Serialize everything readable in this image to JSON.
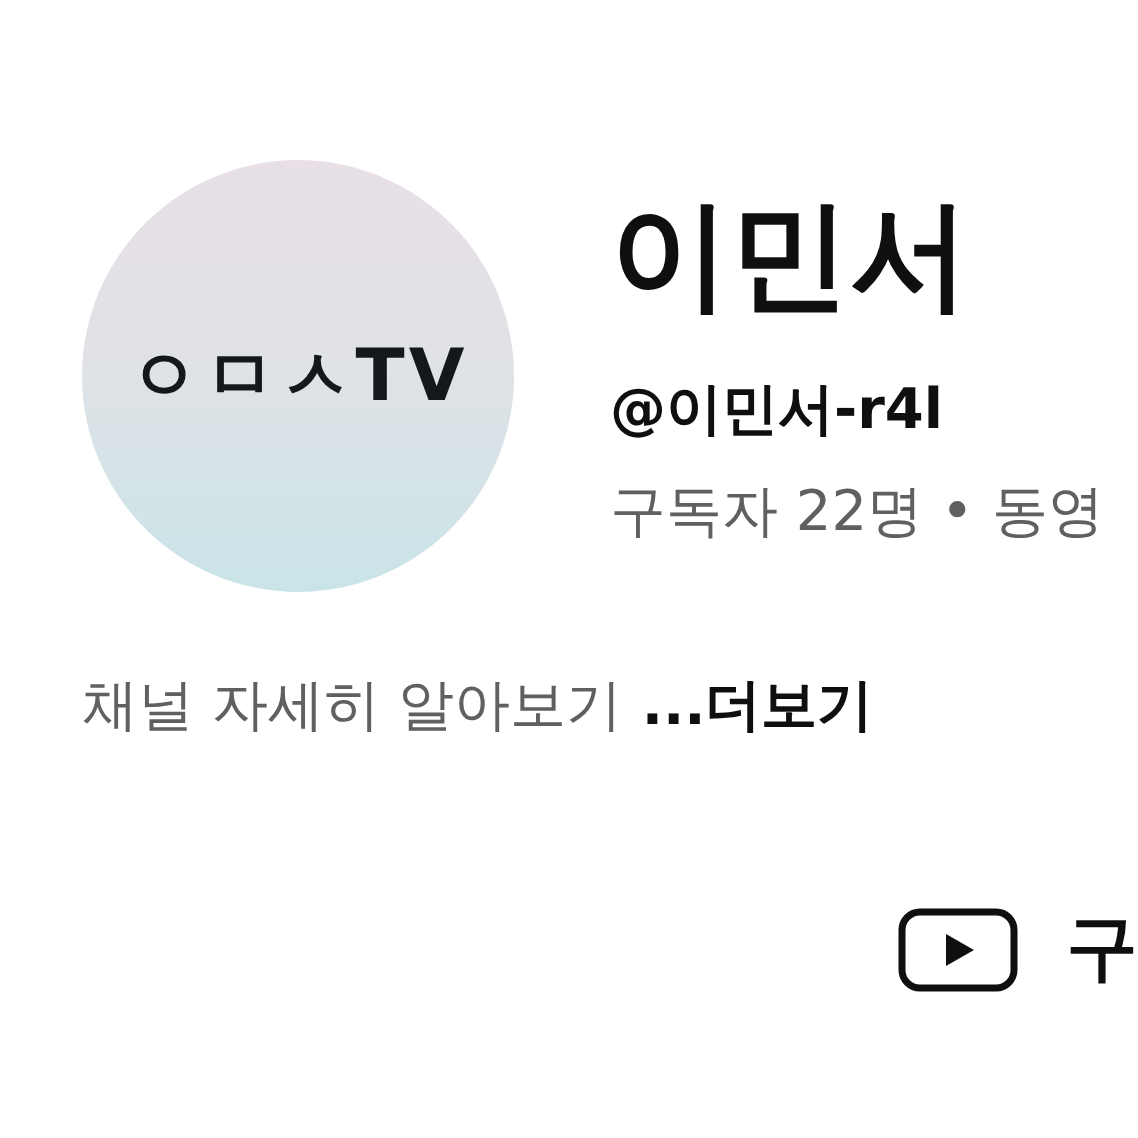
{
  "channel": {
    "avatar_logo": "ㅇㅁㅅTV",
    "name": "이민서",
    "handle": "@이민서-r4l",
    "stats": "구독자 22명 • 동영"
  },
  "description": {
    "text": "채널 자세히 알아보기",
    "more_link": "...더보기"
  },
  "action": {
    "label": "구"
  }
}
